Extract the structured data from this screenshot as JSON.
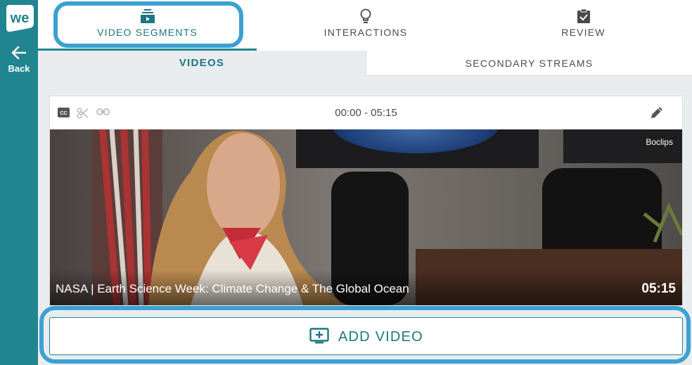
{
  "sidebar": {
    "logo_text": "we",
    "back_label": "Back"
  },
  "top_tabs": [
    {
      "label": "VIDEO SEGMENTS",
      "icon": "video-segments-icon",
      "active": true
    },
    {
      "label": "INTERACTIONS",
      "icon": "lightbulb-icon",
      "active": false
    },
    {
      "label": "REVIEW",
      "icon": "clipboard-check-icon",
      "active": false
    }
  ],
  "sub_tabs": [
    {
      "label": "VIDEOS",
      "active": true
    },
    {
      "label": "SECONDARY STREAMS",
      "active": false
    }
  ],
  "video_card": {
    "toolbar_icons": [
      "closed-captions-icon",
      "scissors-icon",
      "link-icon"
    ],
    "time_range": "00:00 - 05:15",
    "edit_icon": "pencil-icon",
    "source_badge": "Boclips",
    "title": "NASA | Earth Science Week: Climate Change & The Global Ocean",
    "duration": "05:15"
  },
  "add_video": {
    "label": "ADD VIDEO",
    "icon": "add-video-icon"
  },
  "colors": {
    "brand_teal": "#20858f",
    "active_text": "#1d7680",
    "highlight_blue": "#3ba1d2",
    "panel_bg": "#e9ecee"
  }
}
